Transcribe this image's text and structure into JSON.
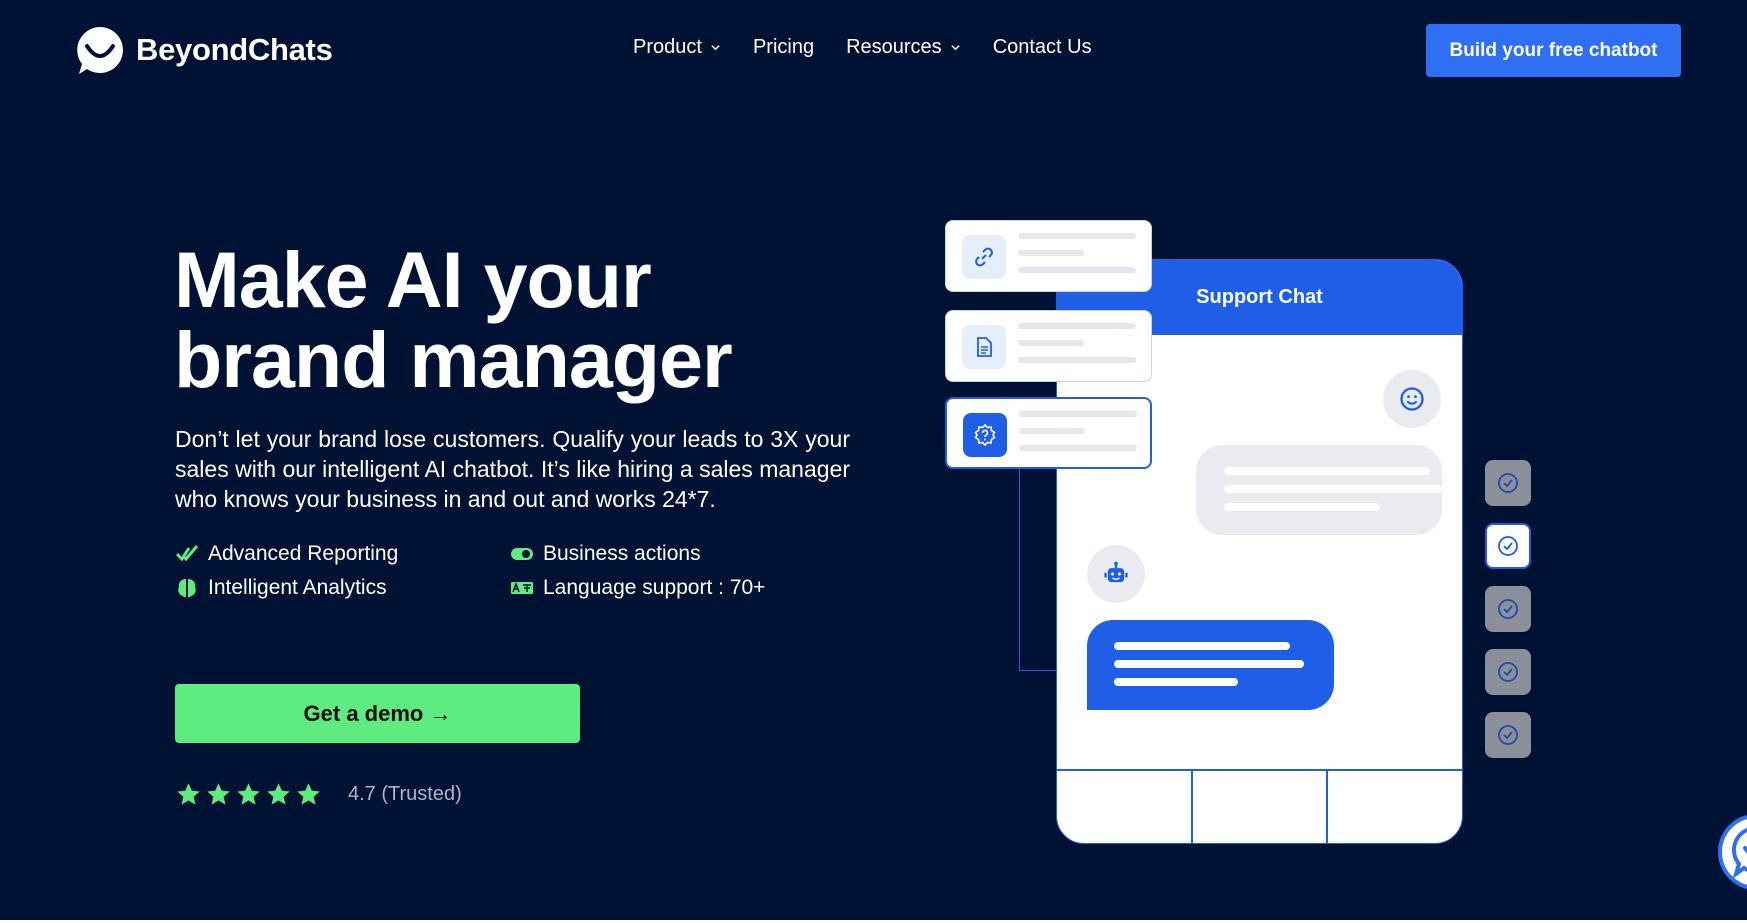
{
  "brand": {
    "name": "BeyondChats",
    "logo_icon": "chat-smile-logo-icon"
  },
  "nav": {
    "items": [
      {
        "label": "Product",
        "dropdown": true
      },
      {
        "label": "Pricing",
        "dropdown": false
      },
      {
        "label": "Resources",
        "dropdown": true
      },
      {
        "label": "Contact Us",
        "dropdown": false
      }
    ]
  },
  "header_cta": {
    "label": "Build your free chatbot"
  },
  "hero": {
    "title_line1": "Make AI your",
    "title_line2": "brand manager",
    "description": "Don’t let your brand lose customers. Qualify your leads to 3X your sales with our intelligent AI chatbot. It’s like hiring a sales manager who knows your business in and out and works 24*7.",
    "features": [
      {
        "label": "Advanced Reporting",
        "icon": "double-check-icon"
      },
      {
        "label": "Business actions",
        "icon": "toggle-icon"
      },
      {
        "label": "Intelligent Analytics",
        "icon": "brain-icon"
      },
      {
        "label": "Language support : 70+",
        "icon": "translate-icon"
      }
    ],
    "demo_button": "Get a demo →",
    "rating": {
      "stars": 5,
      "text": "4.7 (Trusted)"
    }
  },
  "illustration": {
    "chat_title": "Support Chat",
    "source_icons": [
      "link-icon",
      "document-icon",
      "help-badge-icon"
    ],
    "checklist_states": [
      false,
      true,
      false,
      false,
      false
    ]
  },
  "colors": {
    "background": "#001233",
    "accent_blue": "#1f5fe8",
    "cta_blue": "#2f6ff3",
    "accent_green": "#5eeb7f"
  }
}
